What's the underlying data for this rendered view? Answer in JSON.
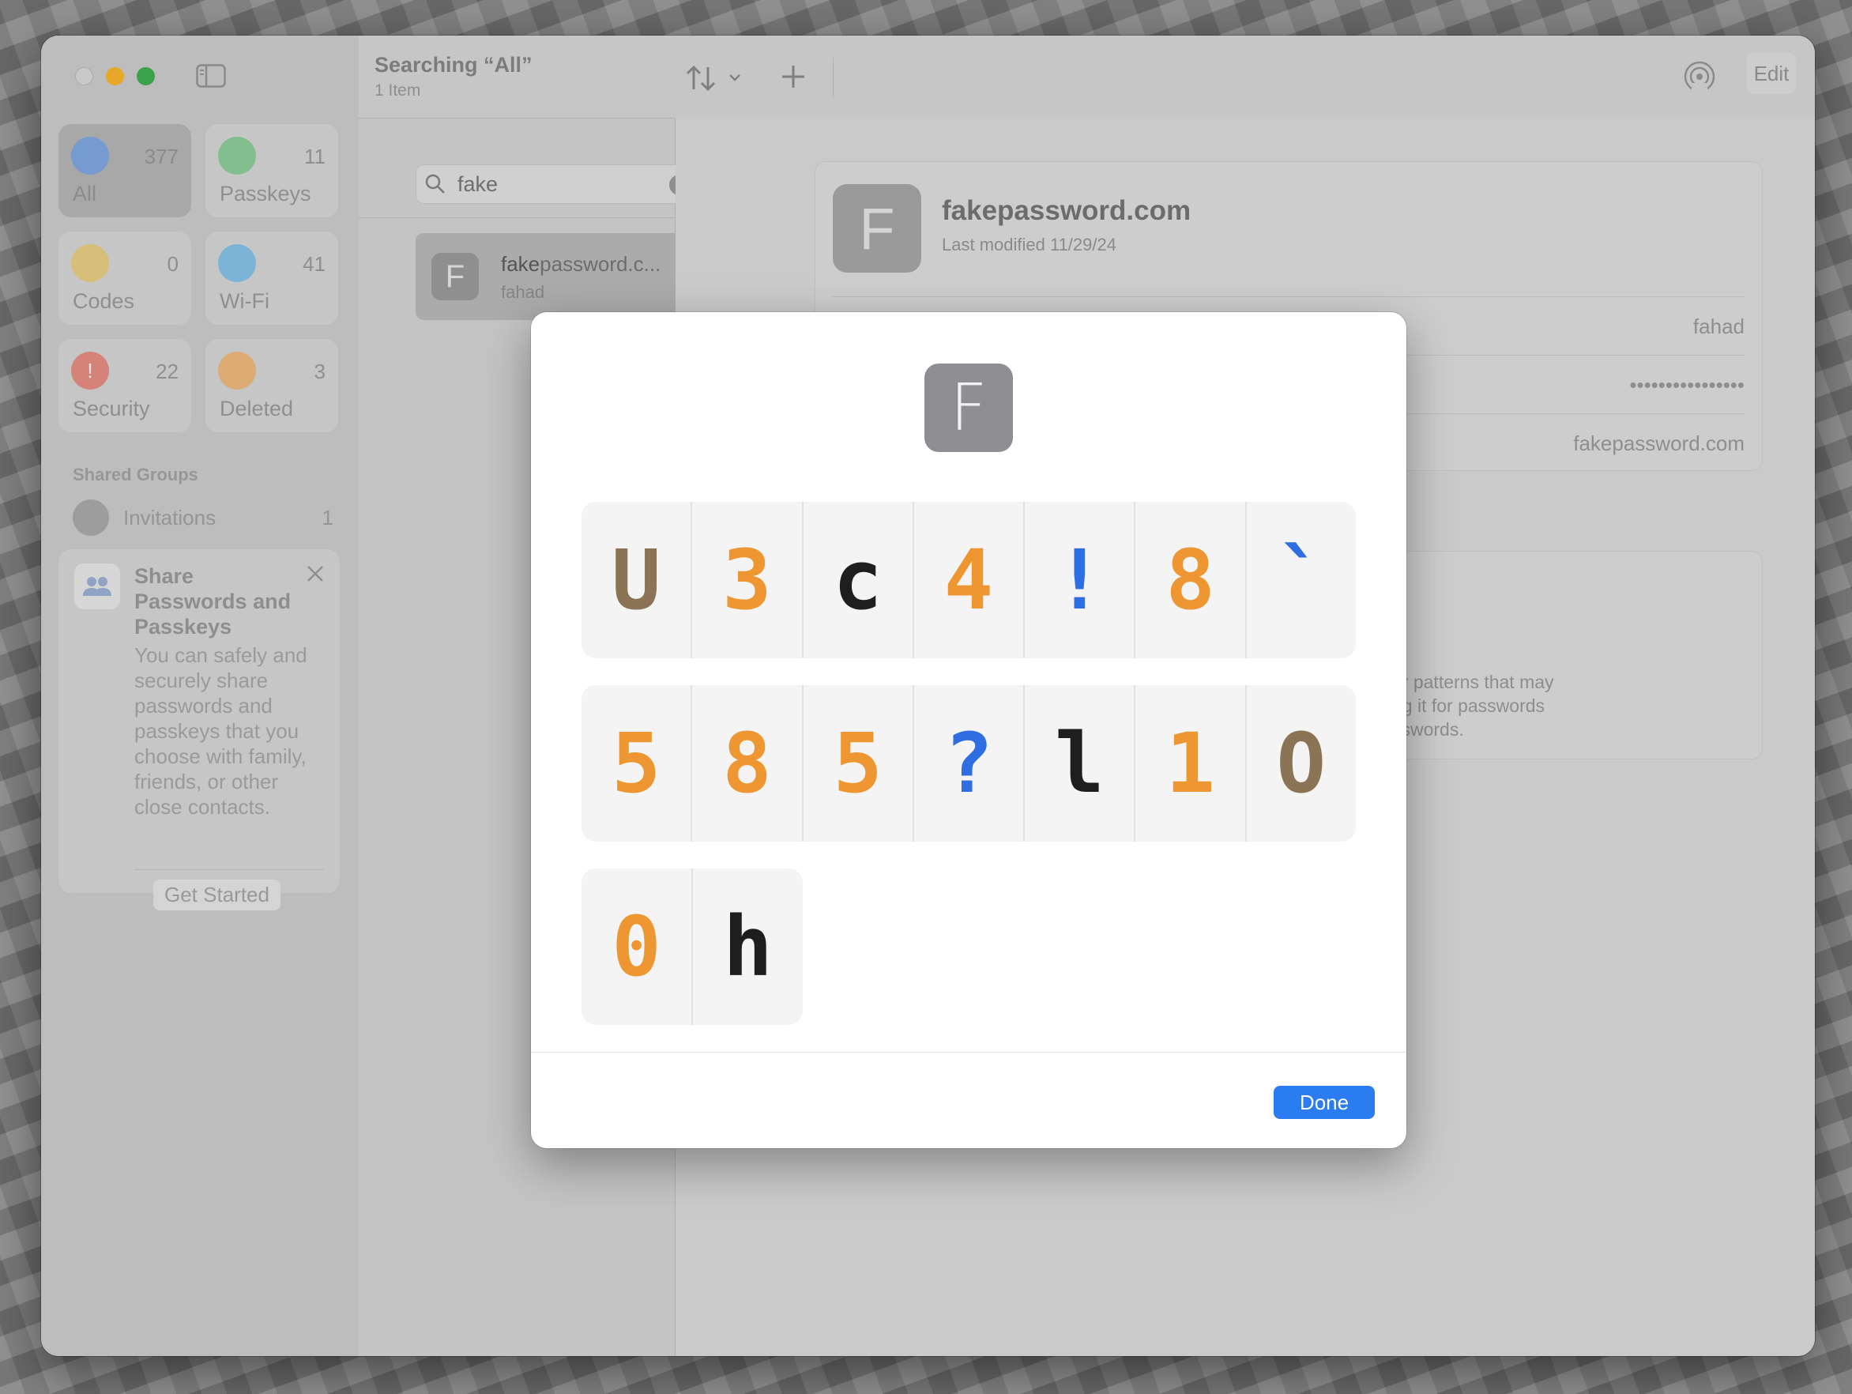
{
  "sidebar": {
    "tiles": [
      {
        "label": "All",
        "count": "377",
        "color": "#4a8ff0",
        "icon": "key-icon",
        "active": true
      },
      {
        "label": "Passkeys",
        "count": "11",
        "color": "#4cb960",
        "icon": "person-icon"
      },
      {
        "label": "Codes",
        "count": "0",
        "color": "#e7b93a",
        "icon": "lock-icon"
      },
      {
        "label": "Wi-Fi",
        "count": "41",
        "color": "#3ea6e6",
        "icon": "wifi-icon"
      },
      {
        "label": "Security",
        "count": "22",
        "color": "#e24b3c",
        "icon": "exclamation-icon"
      },
      {
        "label": "Deleted",
        "count": "3",
        "color": "#ee9732",
        "icon": "trash-icon"
      }
    ],
    "section_label": "Shared Groups",
    "invitations": {
      "label": "Invitations",
      "count": "1"
    },
    "share_card": {
      "title": "Share Passwords and Passkeys",
      "body": "You can safely and securely share passwords and passkeys that you choose with family, friends, or other close contacts.",
      "button": "Get Started"
    }
  },
  "toolbar": {
    "title": "Searching “All”",
    "subtitle": "1 Item",
    "edit_label": "Edit"
  },
  "search": {
    "value": "fake"
  },
  "list": {
    "items": [
      {
        "title_match": "fake",
        "title_rest": "password.c...",
        "subtitle": "fahad",
        "avatar": "F"
      }
    ]
  },
  "detail": {
    "avatar": "F",
    "title": "fakepassword.com",
    "subtitle": "Last modified 11/29/24",
    "username": "fahad",
    "password_masked": "••••••••••••••••",
    "website": "fakepassword.com",
    "note_text": "or patterns that may\nng it for passwords\nsswords."
  },
  "modal": {
    "avatar": "F",
    "characters": [
      [
        {
          "ch": "U",
          "kind": "upper"
        },
        {
          "ch": "3",
          "kind": "digit"
        },
        {
          "ch": "c",
          "kind": "lower"
        },
        {
          "ch": "4",
          "kind": "digit"
        },
        {
          "ch": "!",
          "kind": "sym"
        },
        {
          "ch": "8",
          "kind": "digit"
        },
        {
          "ch": "`",
          "kind": "sym"
        }
      ],
      [
        {
          "ch": "5",
          "kind": "digit"
        },
        {
          "ch": "8",
          "kind": "digit"
        },
        {
          "ch": "5",
          "kind": "digit"
        },
        {
          "ch": "?",
          "kind": "sym"
        },
        {
          "ch": "l",
          "kind": "lower"
        },
        {
          "ch": "1",
          "kind": "digit"
        },
        {
          "ch": "O",
          "kind": "upper"
        }
      ],
      [
        {
          "ch": "0",
          "kind": "digit"
        },
        {
          "ch": "h",
          "kind": "lower"
        }
      ]
    ],
    "done_label": "Done"
  }
}
